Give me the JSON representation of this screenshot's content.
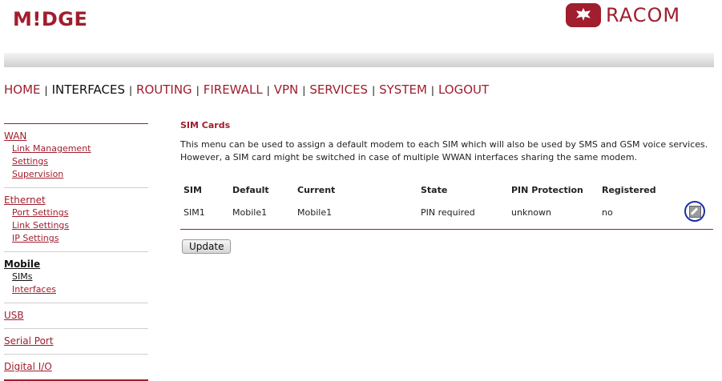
{
  "header": {
    "logo_left": "M!DGE",
    "logo_right": "RACOM"
  },
  "topnav": [
    {
      "label": "HOME"
    },
    {
      "label": "INTERFACES"
    },
    {
      "label": "ROUTING"
    },
    {
      "label": "FIREWALL"
    },
    {
      "label": "VPN"
    },
    {
      "label": "SERVICES"
    },
    {
      "label": "SYSTEM"
    },
    {
      "label": "LOGOUT"
    }
  ],
  "topnav_sep": "|",
  "sidebar": {
    "wan": {
      "title": "WAN",
      "items": [
        "Link Management",
        "Settings",
        "Supervision"
      ]
    },
    "ethernet": {
      "title": "Ethernet",
      "items": [
        "Port Settings",
        "Link Settings",
        "IP Settings"
      ]
    },
    "mobile": {
      "title": "Mobile",
      "items": [
        "SIMs",
        "Interfaces"
      ]
    },
    "usb": {
      "title": "USB"
    },
    "serial": {
      "title": "Serial Port"
    },
    "digital": {
      "title": "Digital I/O"
    }
  },
  "main": {
    "title": "SIM Cards",
    "description": "This menu can be used to assign a default modem to each SIM which will also be used by SMS and GSM voice services. However, a SIM card might be switched in case of multiple WWAN interfaces sharing the same modem.",
    "columns": [
      "SIM",
      "Default",
      "Current",
      "State",
      "PIN Protection",
      "Registered"
    ],
    "rows": [
      {
        "sim": "SIM1",
        "default": "Mobile1",
        "current": "Mobile1",
        "state": "PIN required",
        "pin": "unknown",
        "registered": "no"
      }
    ],
    "update_label": "Update"
  },
  "colors": {
    "brand": "#a01e2d",
    "highlight": "#1a2fa8"
  },
  "icons": {
    "edit": "edit-icon"
  }
}
